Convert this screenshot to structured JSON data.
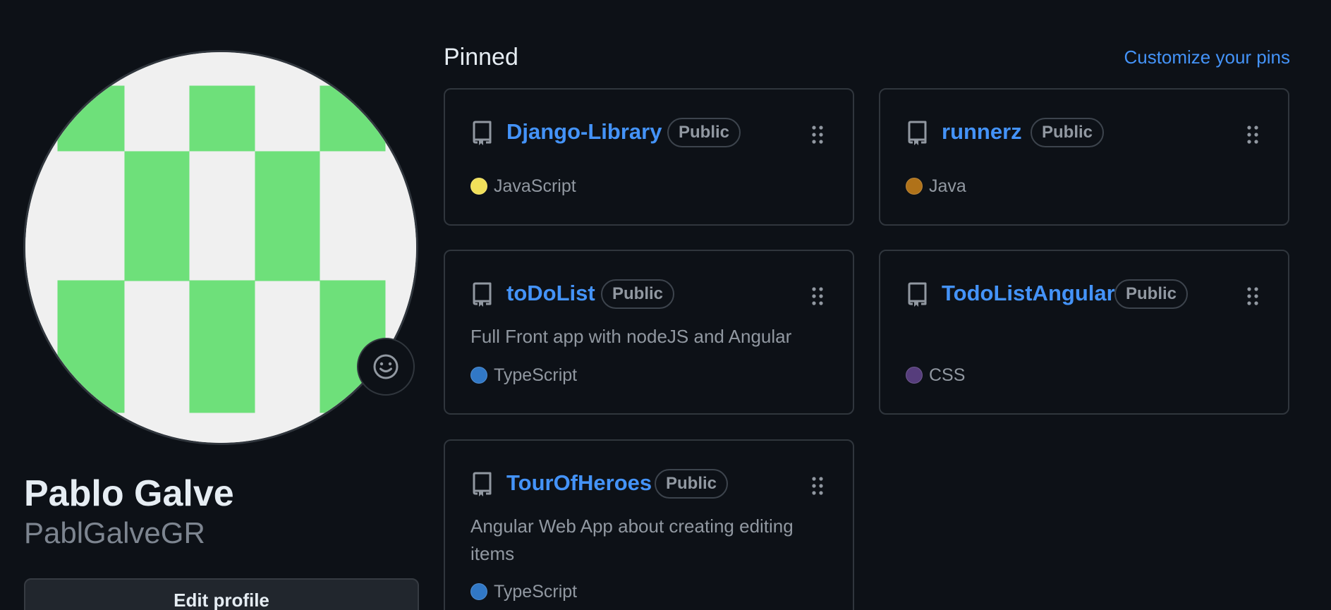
{
  "profile": {
    "name": "Pablo Galve",
    "login": "PablGalveGR",
    "edit_label": "Edit profile",
    "status_icon": "smiley-icon",
    "avatar_colors": {
      "fill": "#6ee07a",
      "background": "#f0f0f0"
    }
  },
  "pinned": {
    "title": "Pinned",
    "customize_label": "Customize your pins",
    "repos": [
      {
        "name": "Django-Library",
        "visibility": "Public",
        "description": "",
        "language": "JavaScript",
        "language_color": "#f1e05a"
      },
      {
        "name": "runnerz",
        "visibility": "Public",
        "description": "",
        "language": "Java",
        "language_color": "#b07219"
      },
      {
        "name": "toDoList",
        "visibility": "Public",
        "description": "Full Front app with nodeJS and Angular",
        "language": "TypeScript",
        "language_color": "#3178c6"
      },
      {
        "name": "TodoListAngular",
        "visibility": "Public",
        "description": "",
        "language": "CSS",
        "language_color": "#563d7c"
      },
      {
        "name": "TourOfHeroes",
        "visibility": "Public",
        "description": "Angular Web App about creating editing items",
        "language": "TypeScript",
        "language_color": "#3178c6"
      }
    ]
  },
  "theme": {
    "background": "#0d1117",
    "link": "#4493f8",
    "muted": "#9198a1",
    "border": "#30363d"
  }
}
